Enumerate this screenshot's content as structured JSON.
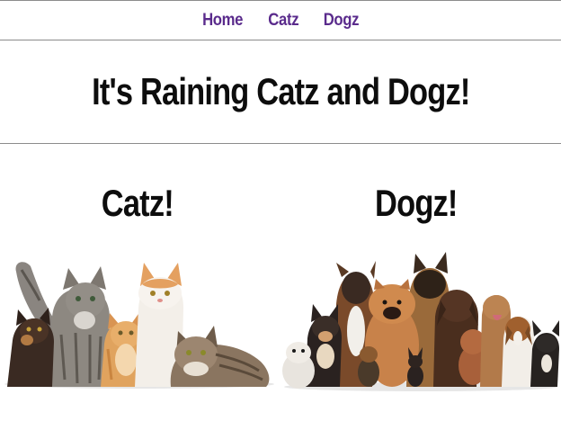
{
  "nav": {
    "items": [
      {
        "label": "Home"
      },
      {
        "label": "Catz"
      },
      {
        "label": "Dogz"
      }
    ],
    "link_color": "#5a2b8c"
  },
  "header": {
    "title": "It's Raining Catz and Dogz!"
  },
  "sections": {
    "cats": {
      "heading": "Catz!"
    },
    "dogs": {
      "heading": "Dogz!"
    }
  }
}
